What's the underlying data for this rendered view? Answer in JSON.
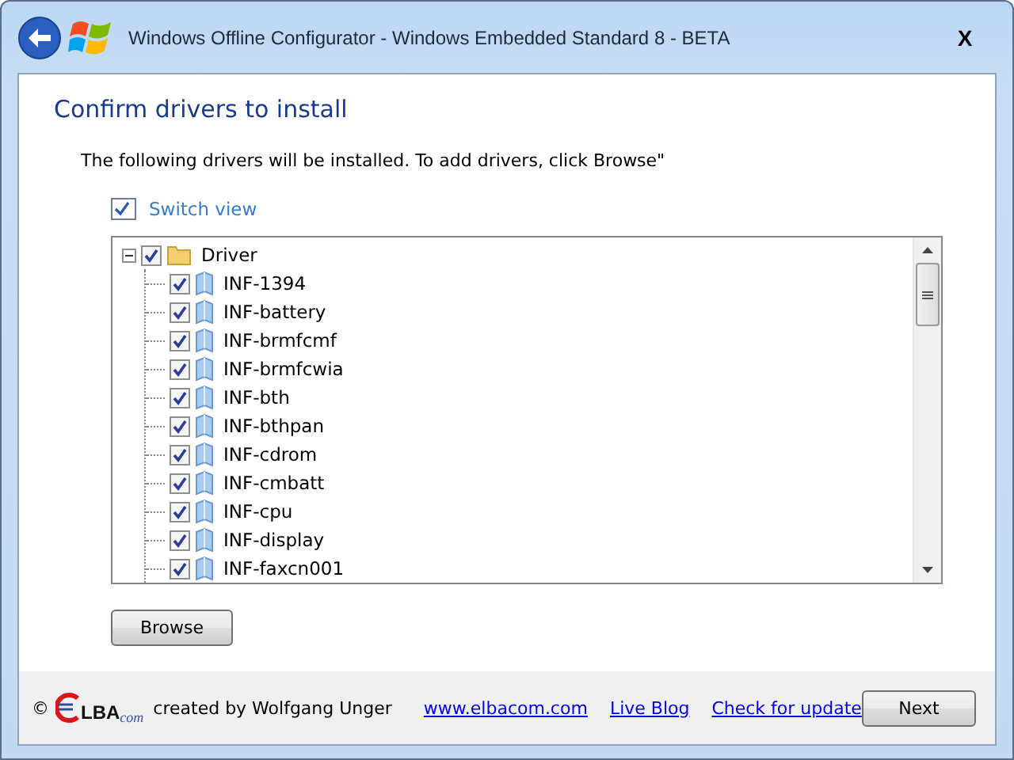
{
  "window": {
    "title": "Windows Offline Configurator - Windows Embedded Standard 8 - BETA",
    "close": "X"
  },
  "heading": "Confirm drivers to install",
  "instruction": "The following drivers will be installed. To add drivers, click Browse\"",
  "switch_view": {
    "label": "Switch view",
    "checked": true
  },
  "tree": {
    "label": "Driver",
    "checked": true,
    "expanded": true,
    "children": [
      {
        "label": "INF-1394",
        "checked": true
      },
      {
        "label": "INF-battery",
        "checked": true
      },
      {
        "label": "INF-brmfcmf",
        "checked": true
      },
      {
        "label": "INF-brmfcwia",
        "checked": true
      },
      {
        "label": "INF-bth",
        "checked": true
      },
      {
        "label": "INF-bthpan",
        "checked": true
      },
      {
        "label": "INF-cdrom",
        "checked": true
      },
      {
        "label": "INF-cmbatt",
        "checked": true
      },
      {
        "label": "INF-cpu",
        "checked": true
      },
      {
        "label": "INF-display",
        "checked": true
      },
      {
        "label": "INF-faxcn001",
        "checked": true
      }
    ]
  },
  "browse_button": "Browse",
  "footer": {
    "copyright": "©",
    "logo_text": "LBA",
    "logo_suffix": "com",
    "credit": "created by Wolfgang Unger",
    "links": [
      "www.elbacom.com",
      "Live Blog",
      "Check for update"
    ]
  },
  "next_button": "Next"
}
